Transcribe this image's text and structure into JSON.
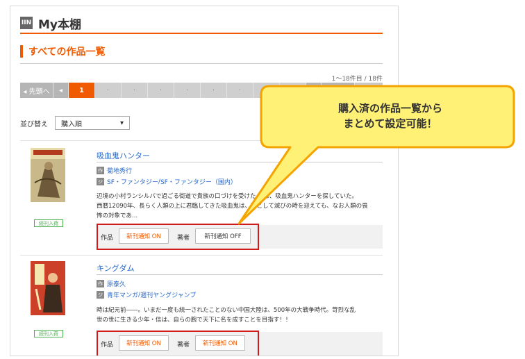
{
  "header": {
    "logo": "IIN",
    "title": "My本棚"
  },
  "section": {
    "title": "すべての作品一覧"
  },
  "count": "1〜18件目 / 18件",
  "pager": {
    "first": "◂ 先頭へ",
    "prev": "◂",
    "current": "1",
    "dot": "·",
    "next": "▸",
    "last": "最後へ ▸"
  },
  "sort": {
    "label": "並び替え",
    "value": "購入順",
    "arrow": "▾"
  },
  "items": [
    {
      "title": "吸血鬼ハンター",
      "author": "菊地秀行",
      "genre_a": "SF・ファンタジー",
      "genre_sep": " / ",
      "genre_b": "SF・ファンタジー（国内）",
      "desc_1": "辺境の小村ランシルバで過ごる街道で貴族の口づけを受けた ...は、吸血鬼ハンターを探していた。",
      "desc_2": "西暦12090年、長らく人類の上に君臨してきた吸血鬼は、種として滅びの時を迎えても、なお人類の畏",
      "desc_3": "怖の対象であ...",
      "badge": "続刊入荷",
      "work_label": "作品",
      "work_btn": "新刊通知 ON",
      "author_label": "著者",
      "author_btn": "新刊通知 OFF"
    },
    {
      "title": "キングダム",
      "author": "原泰久",
      "genre_a": "青年マンガ",
      "genre_sep": " / ",
      "genre_b": "週刊ヤングジャンプ",
      "desc_1": "時は紀元前――。いまだ一度も統一されたことのない中国大陸は、500年の大戦争時代。苛烈な乱",
      "desc_2": "世の世に生きる少年・信は、自らの腕で天下に名を成すことを目指す！！",
      "badge": "続刊入荷",
      "work_label": "作品",
      "work_btn": "新刊通知 ON",
      "author_label": "著者",
      "author_btn": "新刊通知 ON"
    }
  ],
  "tags": {
    "author": "作",
    "genre": "ジ"
  },
  "callout": {
    "line1": "購入済の作品一覧から",
    "line2": "まとめて設定可能！"
  },
  "colors": {
    "accent": "#f05a00",
    "link": "#2266cc",
    "callout_fill": "#fff176",
    "callout_stroke": "#f5a300",
    "highlight": "#d11a1a"
  }
}
